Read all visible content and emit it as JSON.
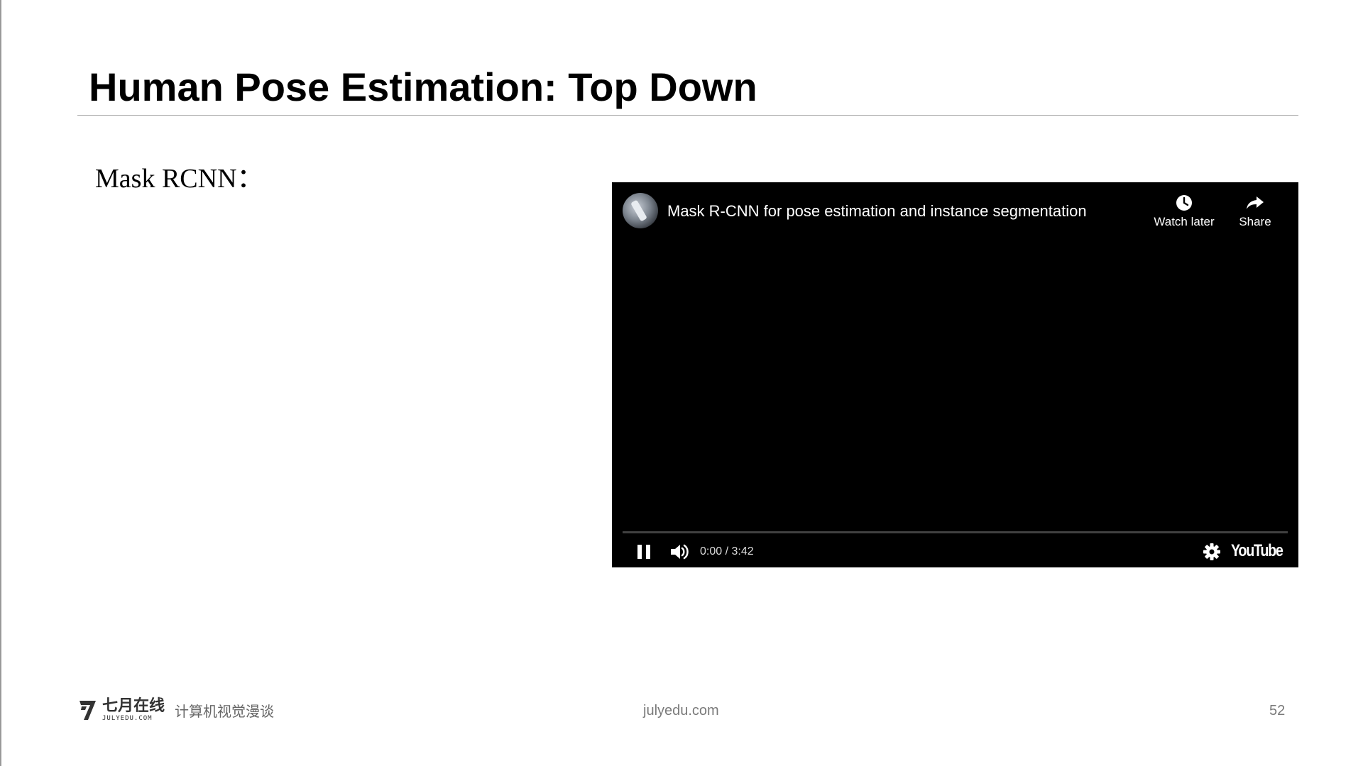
{
  "slide": {
    "title": "Human Pose Estimation: Top Down",
    "subtitle": "Mask RCNN："
  },
  "video": {
    "title": "Mask R-CNN for pose estimation and instance segmentation",
    "watch_later_label": "Watch later",
    "share_label": "Share",
    "time": "0:00 / 3:42",
    "progress": 0,
    "logo_text": "YouTube",
    "icons": {
      "watch_later": "clock-icon",
      "share": "share-arrow-icon",
      "pause": "pause-icon",
      "volume": "volume-icon",
      "settings": "gear-icon"
    }
  },
  "footer": {
    "brand_cn": "七月在线",
    "brand_en": "JULYEDU.COM",
    "brand_sub": "计算机视觉漫谈",
    "url": "julyedu.com",
    "page_number": "52"
  }
}
